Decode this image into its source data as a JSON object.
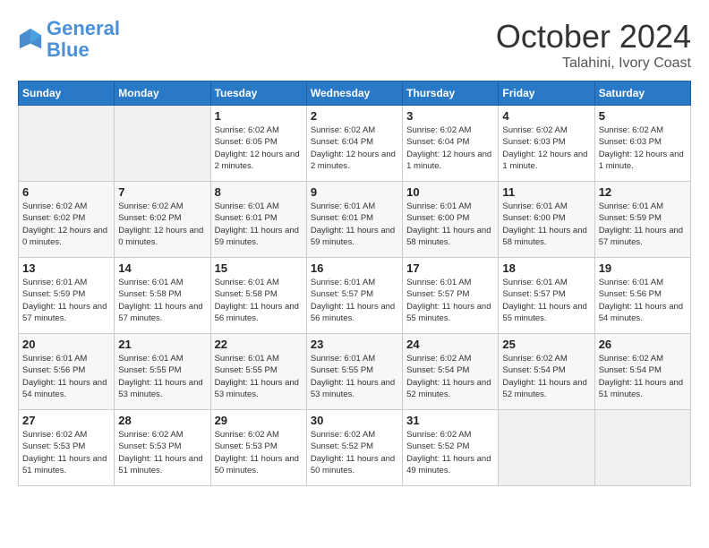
{
  "logo": {
    "line1": "General",
    "line2": "Blue"
  },
  "title": "October 2024",
  "location": "Talahini, Ivory Coast",
  "headers": [
    "Sunday",
    "Monday",
    "Tuesday",
    "Wednesday",
    "Thursday",
    "Friday",
    "Saturday"
  ],
  "weeks": [
    [
      {
        "day": "",
        "content": ""
      },
      {
        "day": "",
        "content": ""
      },
      {
        "day": "1",
        "content": "Sunrise: 6:02 AM\nSunset: 6:05 PM\nDaylight: 12 hours and 2 minutes."
      },
      {
        "day": "2",
        "content": "Sunrise: 6:02 AM\nSunset: 6:04 PM\nDaylight: 12 hours and 2 minutes."
      },
      {
        "day": "3",
        "content": "Sunrise: 6:02 AM\nSunset: 6:04 PM\nDaylight: 12 hours and 1 minute."
      },
      {
        "day": "4",
        "content": "Sunrise: 6:02 AM\nSunset: 6:03 PM\nDaylight: 12 hours and 1 minute."
      },
      {
        "day": "5",
        "content": "Sunrise: 6:02 AM\nSunset: 6:03 PM\nDaylight: 12 hours and 1 minute."
      }
    ],
    [
      {
        "day": "6",
        "content": "Sunrise: 6:02 AM\nSunset: 6:02 PM\nDaylight: 12 hours and 0 minutes."
      },
      {
        "day": "7",
        "content": "Sunrise: 6:02 AM\nSunset: 6:02 PM\nDaylight: 12 hours and 0 minutes."
      },
      {
        "day": "8",
        "content": "Sunrise: 6:01 AM\nSunset: 6:01 PM\nDaylight: 11 hours and 59 minutes."
      },
      {
        "day": "9",
        "content": "Sunrise: 6:01 AM\nSunset: 6:01 PM\nDaylight: 11 hours and 59 minutes."
      },
      {
        "day": "10",
        "content": "Sunrise: 6:01 AM\nSunset: 6:00 PM\nDaylight: 11 hours and 58 minutes."
      },
      {
        "day": "11",
        "content": "Sunrise: 6:01 AM\nSunset: 6:00 PM\nDaylight: 11 hours and 58 minutes."
      },
      {
        "day": "12",
        "content": "Sunrise: 6:01 AM\nSunset: 5:59 PM\nDaylight: 11 hours and 57 minutes."
      }
    ],
    [
      {
        "day": "13",
        "content": "Sunrise: 6:01 AM\nSunset: 5:59 PM\nDaylight: 11 hours and 57 minutes."
      },
      {
        "day": "14",
        "content": "Sunrise: 6:01 AM\nSunset: 5:58 PM\nDaylight: 11 hours and 57 minutes."
      },
      {
        "day": "15",
        "content": "Sunrise: 6:01 AM\nSunset: 5:58 PM\nDaylight: 11 hours and 56 minutes."
      },
      {
        "day": "16",
        "content": "Sunrise: 6:01 AM\nSunset: 5:57 PM\nDaylight: 11 hours and 56 minutes."
      },
      {
        "day": "17",
        "content": "Sunrise: 6:01 AM\nSunset: 5:57 PM\nDaylight: 11 hours and 55 minutes."
      },
      {
        "day": "18",
        "content": "Sunrise: 6:01 AM\nSunset: 5:57 PM\nDaylight: 11 hours and 55 minutes."
      },
      {
        "day": "19",
        "content": "Sunrise: 6:01 AM\nSunset: 5:56 PM\nDaylight: 11 hours and 54 minutes."
      }
    ],
    [
      {
        "day": "20",
        "content": "Sunrise: 6:01 AM\nSunset: 5:56 PM\nDaylight: 11 hours and 54 minutes."
      },
      {
        "day": "21",
        "content": "Sunrise: 6:01 AM\nSunset: 5:55 PM\nDaylight: 11 hours and 53 minutes."
      },
      {
        "day": "22",
        "content": "Sunrise: 6:01 AM\nSunset: 5:55 PM\nDaylight: 11 hours and 53 minutes."
      },
      {
        "day": "23",
        "content": "Sunrise: 6:01 AM\nSunset: 5:55 PM\nDaylight: 11 hours and 53 minutes."
      },
      {
        "day": "24",
        "content": "Sunrise: 6:02 AM\nSunset: 5:54 PM\nDaylight: 11 hours and 52 minutes."
      },
      {
        "day": "25",
        "content": "Sunrise: 6:02 AM\nSunset: 5:54 PM\nDaylight: 11 hours and 52 minutes."
      },
      {
        "day": "26",
        "content": "Sunrise: 6:02 AM\nSunset: 5:54 PM\nDaylight: 11 hours and 51 minutes."
      }
    ],
    [
      {
        "day": "27",
        "content": "Sunrise: 6:02 AM\nSunset: 5:53 PM\nDaylight: 11 hours and 51 minutes."
      },
      {
        "day": "28",
        "content": "Sunrise: 6:02 AM\nSunset: 5:53 PM\nDaylight: 11 hours and 51 minutes."
      },
      {
        "day": "29",
        "content": "Sunrise: 6:02 AM\nSunset: 5:53 PM\nDaylight: 11 hours and 50 minutes."
      },
      {
        "day": "30",
        "content": "Sunrise: 6:02 AM\nSunset: 5:52 PM\nDaylight: 11 hours and 50 minutes."
      },
      {
        "day": "31",
        "content": "Sunrise: 6:02 AM\nSunset: 5:52 PM\nDaylight: 11 hours and 49 minutes."
      },
      {
        "day": "",
        "content": ""
      },
      {
        "day": "",
        "content": ""
      }
    ]
  ]
}
